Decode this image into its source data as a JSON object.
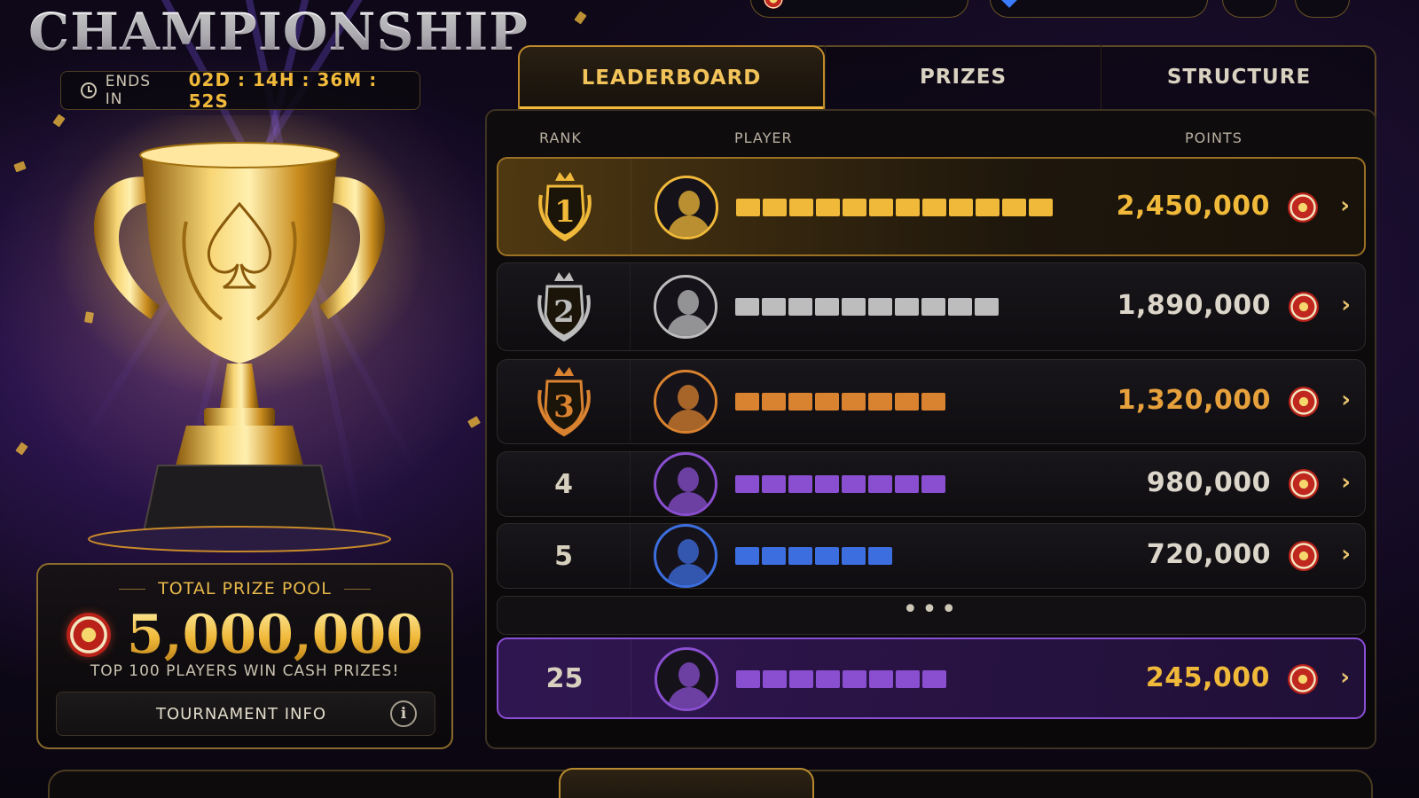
{
  "title": "CHAMPIONSHIP",
  "timer": {
    "label": "ENDS IN",
    "value": "02D : 14H : 36M : 52S"
  },
  "prize_pool": {
    "label": "TOTAL PRIZE POOL",
    "amount": "5,000,000",
    "subtitle": "TOP 100 PLAYERS WIN CASH PRIZES!",
    "info_button": "TOURNAMENT INFO"
  },
  "tabs": [
    {
      "label": "LEADERBOARD",
      "active": true
    },
    {
      "label": "PRIZES",
      "active": false
    },
    {
      "label": "STRUCTURE",
      "active": false
    }
  ],
  "columns": {
    "rank": "RANK",
    "player": "PLAYER",
    "points": "POINTS"
  },
  "rows": [
    {
      "rank": "1",
      "points": "2,450,000",
      "name_segments": 12,
      "tier": "gold"
    },
    {
      "rank": "2",
      "points": "1,890,000",
      "name_segments": 10,
      "tier": "silver"
    },
    {
      "rank": "3",
      "points": "1,320,000",
      "name_segments": 8,
      "tier": "bronze"
    },
    {
      "rank": "4",
      "points": "980,000",
      "name_segments": 8,
      "tier": "purple"
    },
    {
      "rank": "5",
      "points": "720,000",
      "name_segments": 6,
      "tier": "blue"
    }
  ],
  "separator": "•••",
  "self_row": {
    "rank": "25",
    "points": "245,000",
    "name_segments": 8,
    "tier": "purple"
  },
  "colors": {
    "gold": "#f0b93a",
    "silver": "#bdbdbd",
    "bronze": "#d9822f",
    "purple": "#8a4fd0",
    "blue": "#3d6ee0",
    "accent": "#f1c35a"
  },
  "icons": [
    "clock-icon",
    "chip-icon",
    "info-icon",
    "coin-icon",
    "chevron-right-icon",
    "trophy-icon",
    "rank-badge-icon",
    "avatar-icon"
  ]
}
